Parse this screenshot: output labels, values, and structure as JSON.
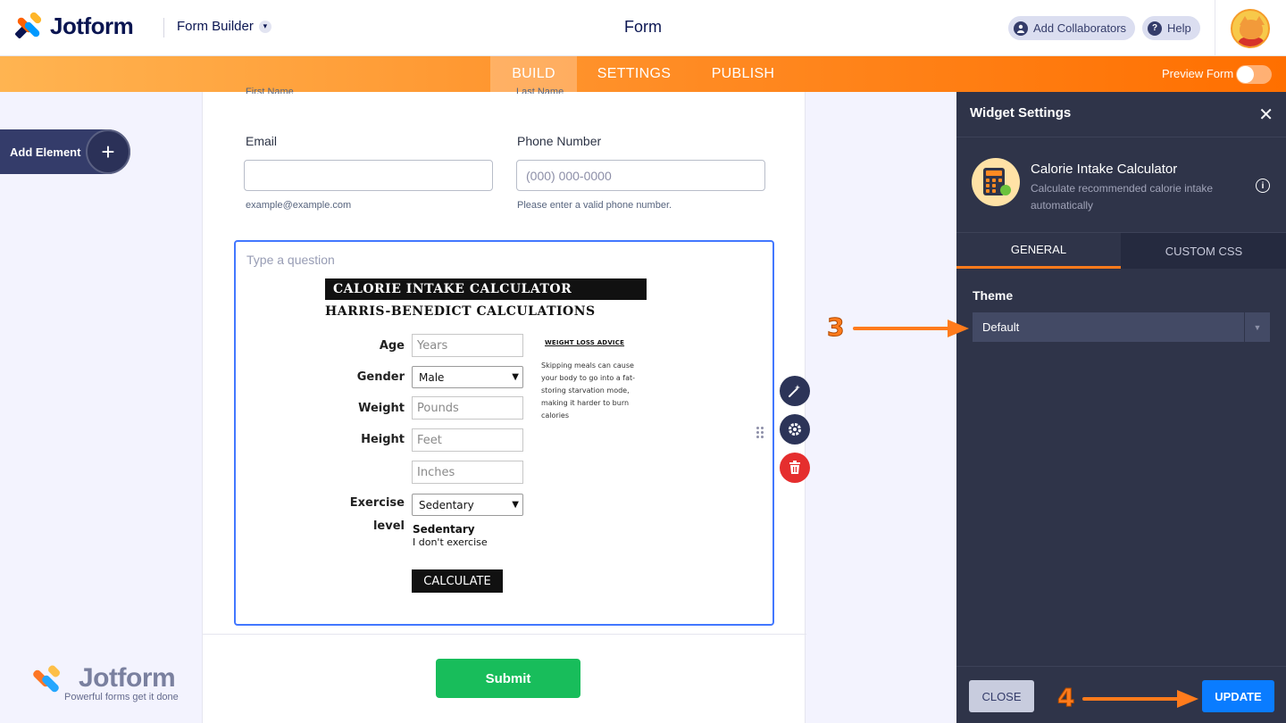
{
  "header": {
    "brand": "Jotform",
    "mode_dropdown": "Form Builder",
    "form_title": "Form",
    "add_collaborators": "Add Collaborators",
    "help": "Help"
  },
  "nav": {
    "tabs": [
      {
        "label": "BUILD",
        "active": true
      },
      {
        "label": "SETTINGS",
        "active": false
      },
      {
        "label": "PUBLISH",
        "active": false
      }
    ],
    "preview_label": "Preview Form"
  },
  "sidebar": {
    "add_element": "Add Element"
  },
  "form": {
    "cut_first_name": "First Name",
    "cut_last_name": "Last Name",
    "email": {
      "label": "Email",
      "value": "",
      "hint": "example@example.com"
    },
    "phone": {
      "label": "Phone Number",
      "placeholder": "(000) 000-0000",
      "hint": "Please enter a valid phone number."
    },
    "question_placeholder": "Type a question",
    "submit": "Submit"
  },
  "calculator": {
    "title": "CALORIE INTAKE CALCULATOR",
    "subtitle": "HARRIS-BENEDICT CALCULATIONS",
    "age_label": "Age",
    "age_placeholder": "Years",
    "gender_label": "Gender",
    "gender_value": "Male",
    "weight_label": "Weight",
    "weight_placeholder": "Pounds",
    "height_label": "Height",
    "height_feet_placeholder": "Feet",
    "height_inches_placeholder": "Inches",
    "exercise_label_1": "Exercise",
    "exercise_label_2": "level",
    "exercise_value": "Sedentary",
    "exercise_title": "Sedentary",
    "exercise_desc": "I don't exercise",
    "calculate": "CALCULATE",
    "advice_heading": "WEIGHT LOSS ADVICE",
    "advice_text": "Skipping meals can cause your body to go into a fat-storing starvation mode, making it harder to burn calories"
  },
  "watermark": {
    "brand": "Jotform",
    "tagline": "Powerful forms get it done"
  },
  "panel": {
    "title": "Widget Settings",
    "widget_name": "Calorie Intake Calculator",
    "widget_desc": "Calculate recommended calorie intake automatically",
    "tabs": [
      {
        "label": "GENERAL",
        "active": true
      },
      {
        "label": "CUSTOM CSS",
        "active": false
      }
    ],
    "theme_label": "Theme",
    "theme_value": "Default",
    "close": "CLOSE",
    "update": "UPDATE"
  },
  "annotations": {
    "step3": "3",
    "step4": "4"
  },
  "colors": {
    "brand_navy": "#0a1551",
    "nav_orange": "#ff8a22",
    "active_blue": "#4277ff",
    "submit_green": "#18bd5b",
    "update_blue": "#0a7cff",
    "panel_bg": "#2f3449",
    "delete_red": "#e52e2e"
  }
}
